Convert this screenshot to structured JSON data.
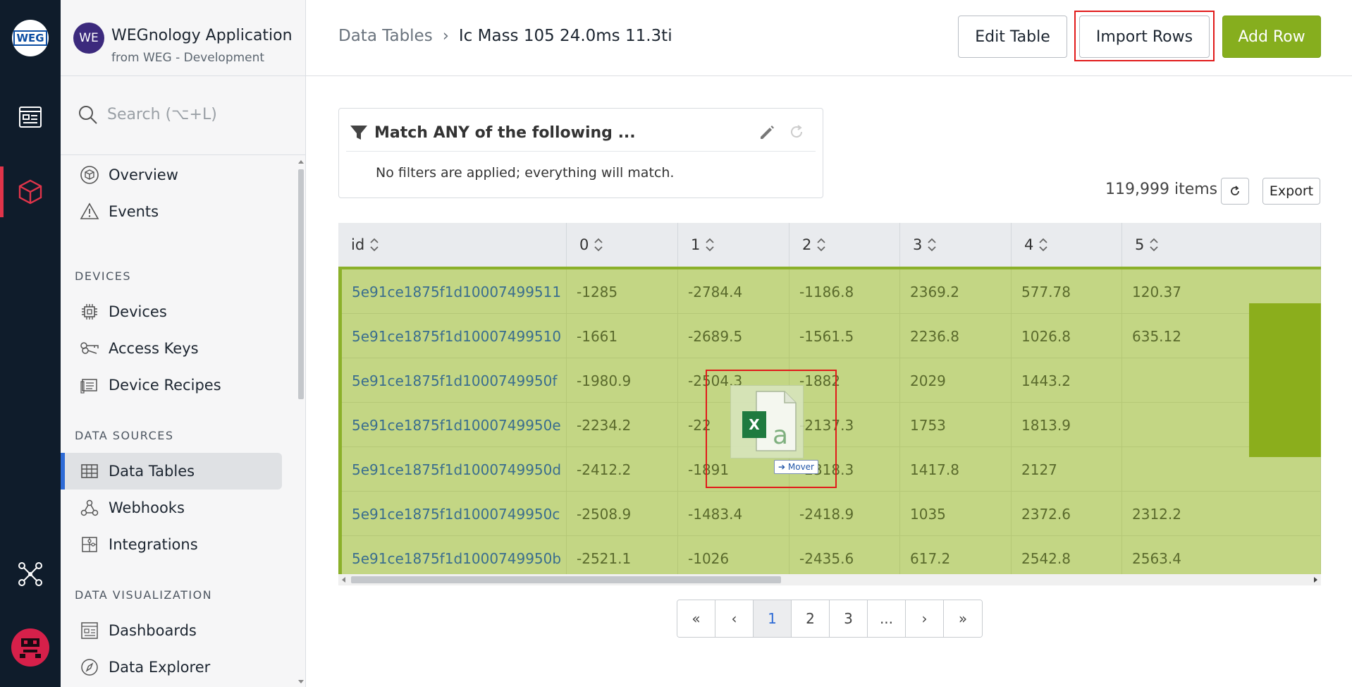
{
  "app": {
    "avatar_initials": "WE",
    "name": "WEGnology Application",
    "org": "from WEG - Development"
  },
  "rail": {
    "logo_text": "WEG",
    "items": [
      "apps-icon",
      "cube-icon",
      "network-icon",
      "user-avatar-icon"
    ]
  },
  "search": {
    "placeholder": "Search (⌥+L)"
  },
  "sidebar": {
    "top_items": [
      {
        "label": "Overview",
        "icon": "cube-circle-icon"
      },
      {
        "label": "Events",
        "icon": "warning-triangle-icon"
      }
    ],
    "sections": [
      {
        "title": "DEVICES",
        "items": [
          {
            "label": "Devices",
            "icon": "chip-icon"
          },
          {
            "label": "Access Keys",
            "icon": "keys-icon"
          },
          {
            "label": "Device Recipes",
            "icon": "recipe-icon"
          }
        ]
      },
      {
        "title": "DATA SOURCES",
        "items": [
          {
            "label": "Data Tables",
            "icon": "table-icon",
            "selected": true
          },
          {
            "label": "Webhooks",
            "icon": "webhook-icon"
          },
          {
            "label": "Integrations",
            "icon": "puzzle-icon"
          }
        ]
      },
      {
        "title": "DATA VISUALIZATION",
        "items": [
          {
            "label": "Dashboards",
            "icon": "dashboard-icon"
          },
          {
            "label": "Data Explorer",
            "icon": "compass-icon"
          }
        ]
      }
    ]
  },
  "header": {
    "breadcrumb_root": "Data Tables",
    "breadcrumb_sep": "›",
    "breadcrumb_current": "Ic Mass 105 24.0ms 11.3ti",
    "edit_label": "Edit Table",
    "import_label": "Import Rows",
    "add_label": "Add Row"
  },
  "filter": {
    "title": "Match ANY of the following ...",
    "empty_text": "No filters are applied; everything will match."
  },
  "table_meta": {
    "count": "119,999 items",
    "export_label": "Export"
  },
  "table": {
    "columns": [
      "id",
      "0",
      "1",
      "2",
      "3",
      "4",
      "5"
    ],
    "rows": [
      [
        "5e91ce1875f1d10007499511",
        "-1285",
        "-2784.4",
        "-1186.8",
        "2369.2",
        "577.78",
        "120.37"
      ],
      [
        "5e91ce1875f1d10007499510",
        "-1661",
        "-2689.5",
        "-1561.5",
        "2236.8",
        "1026.8",
        "635.12"
      ],
      [
        "5e91ce1875f1d1000749950f",
        "-1980.9",
        "-2504.3",
        "-1882",
        "2029",
        "1443.2",
        ""
      ],
      [
        "5e91ce1875f1d1000749950e",
        "-2234.2",
        "-22",
        "-2137.3",
        "1753",
        "1813.9",
        ""
      ],
      [
        "5e91ce1875f1d1000749950d",
        "-2412.2",
        "-1891",
        "-2318.3",
        "1417.8",
        "2127",
        ""
      ],
      [
        "5e91ce1875f1d1000749950c",
        "-2508.9",
        "-1483.4",
        "-2418.9",
        "1035",
        "2372.6",
        "2312.2"
      ],
      [
        "5e91ce1875f1d1000749950b",
        "-2521.1",
        "-1026",
        "-2435.6",
        "617.2",
        "2542.8",
        "2563.4"
      ]
    ]
  },
  "drag": {
    "file_icon": "excel-file-icon",
    "mover_label": "➔ Mover"
  },
  "pagination": {
    "items": [
      "«",
      "‹",
      "1",
      "2",
      "3",
      "...",
      "›",
      "»"
    ],
    "active": "1"
  },
  "colors": {
    "accent_green": "#86ae1e",
    "rail_bg": "#0f1c2b",
    "rail_active": "#e0344a",
    "row_highlight": "#c3d684",
    "highlight_box": "#e11a1a"
  }
}
